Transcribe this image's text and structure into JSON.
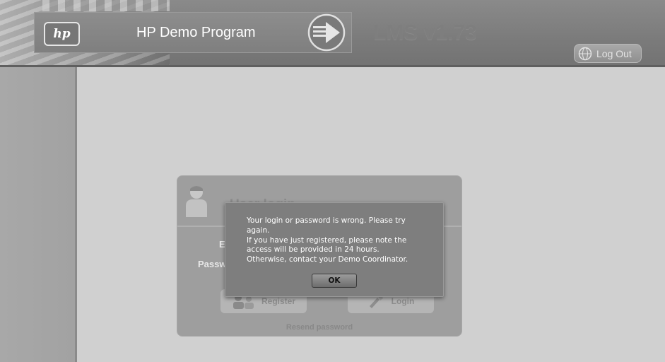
{
  "header": {
    "logo_text": "hp",
    "program_title": "HP Demo Program",
    "app_version": "LMS v1.73",
    "logout_label": "Log Out"
  },
  "login_panel": {
    "title": "User login",
    "email_label": "E",
    "password_label": "Passw",
    "register_label": "Register",
    "login_label": "Login",
    "resend_password_label": "Resend password"
  },
  "dialog": {
    "message_lines": [
      "Your login or password is wrong. Please try",
      "again.",
      "If you have just registered, please note the",
      "access will be provided in 24 hours.",
      "Otherwise, contact your Demo Coordinator."
    ],
    "ok_label": "OK"
  },
  "icons": {
    "hp_logo": "hp-logo-icon",
    "arrow": "arrow-circle-icon",
    "globe": "globe-icon",
    "user": "user-icon",
    "register": "register-icon",
    "login": "login-icon"
  }
}
